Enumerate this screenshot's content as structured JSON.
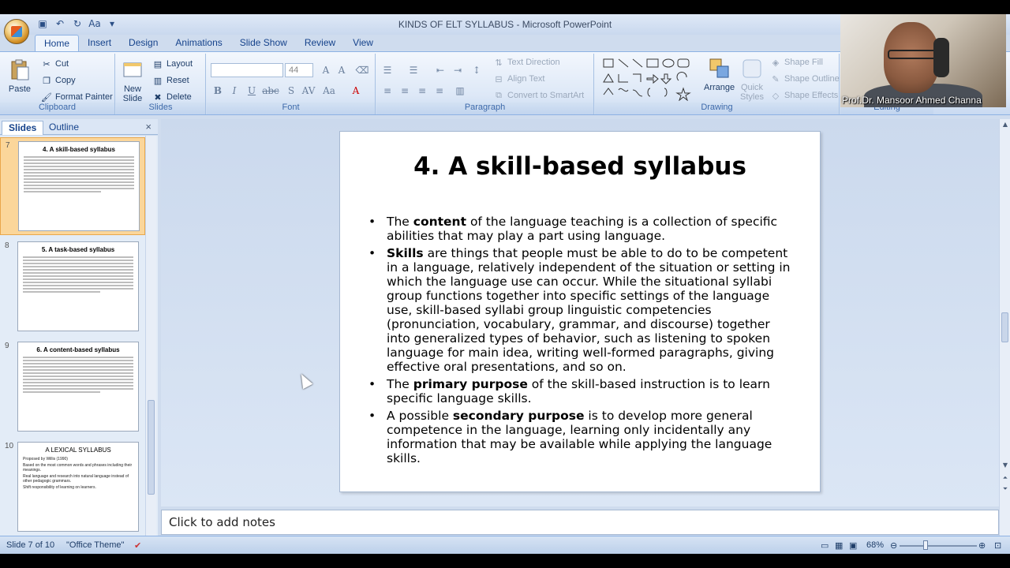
{
  "window": {
    "title": "KINDS OF ELT SYLLABUS - Microsoft PowerPoint"
  },
  "tabs": [
    "Home",
    "Insert",
    "Design",
    "Animations",
    "Slide Show",
    "Review",
    "View"
  ],
  "ribbon": {
    "clipboard": {
      "label": "Clipboard",
      "paste": "Paste",
      "cut": "Cut",
      "copy": "Copy",
      "format_painter": "Format Painter"
    },
    "slides": {
      "label": "Slides",
      "new_slide": "New",
      "new_slide2": "Slide",
      "layout": "Layout",
      "reset": "Reset",
      "delete": "Delete"
    },
    "font": {
      "label": "Font",
      "size": "44"
    },
    "paragraph": {
      "label": "Paragraph",
      "text_direction": "Text Direction",
      "align_text": "Align Text",
      "convert": "Convert to SmartArt"
    },
    "drawing": {
      "label": "Drawing",
      "arrange": "Arrange",
      "quick_styles": "Quick",
      "quick_styles2": "Styles",
      "shape_fill": "Shape Fill",
      "shape_outline": "Shape Outline",
      "shape_effects": "Shape Effects"
    },
    "editing": {
      "label": "Editing"
    }
  },
  "slides_pane": {
    "tab_slides": "Slides",
    "tab_outline": "Outline",
    "close": "×",
    "thumbnails": [
      {
        "num": "7",
        "title": "4.  A skill-based syllabus"
      },
      {
        "num": "8",
        "title": "5. A task-based syllabus"
      },
      {
        "num": "9",
        "title": "6. A content-based syllabus"
      },
      {
        "num": "10",
        "title": "A LEXICAL SYLLABUS",
        "lines": [
          "Proposed by Willis (1990)",
          "Based on the most common words and phrases including their meanings.",
          "Real language and research into natural language instead of other pedagogic grammars.",
          "Shift responsibility of learning on learners."
        ]
      }
    ]
  },
  "slide": {
    "title": "4.  A skill-based syllabus",
    "bullets": [
      {
        "pre": "The ",
        "bold": "content",
        "post": " of the language teaching is a collection of specific abilities that may play a part using language."
      },
      {
        "pre": "",
        "bold": "Skills",
        "post": " are things that people must be able to do to be competent in a language, relatively independent of the situation or setting in which the language use can occur. While the situational syllabi group functions together into specific settings of the language use, skill-based syllabi group linguistic competencies (pronunciation, vocabulary, grammar, and discourse) together into generalized types of behavior, such as listening to spoken language for main idea, writing well-formed paragraphs, giving effective oral presentations, and so on."
      },
      {
        "pre": "The ",
        "bold": "primary purpose",
        "post": " of the skill-based instruction is to learn specific language skills."
      },
      {
        "pre": "A possible ",
        "bold": "secondary purpose",
        "post": " is to develop more general competence in the language, learning only incidentally any information that may be available while applying the language skills."
      }
    ]
  },
  "notes": {
    "placeholder": "Click to add notes"
  },
  "status": {
    "slide_of": "Slide 7 of 10",
    "theme": "\"Office Theme\"",
    "zoom": "68%"
  },
  "webcam": {
    "caption": "Prof.Dr. Mansoor Ahmed Channa"
  }
}
